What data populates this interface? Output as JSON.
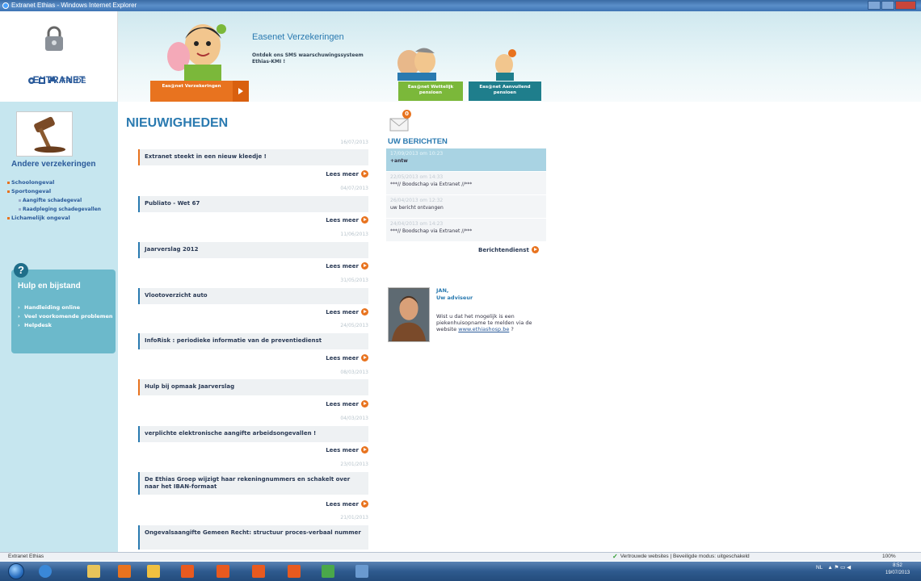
{
  "window": {
    "title": "Extranet Ethias - Windows Internet Explorer"
  },
  "header": {
    "logo_title": "EXTRANET",
    "lang_fr": "FR",
    "lang_de": "DE",
    "promo_title": "Easenet Verzekeringen",
    "promo_text": "Ontdek ons SMS waarschuwingssysteem Ethias-KMI !",
    "btn_verzekeringen": "Eas@net Verzekeringen",
    "btn_wettelijk": "Eas@net Wettelijk pensioen",
    "btn_aanvullend": "Eas@net Aanvullend pensioen"
  },
  "sidebar": {
    "title": "Andere verzekeringen",
    "items": [
      {
        "label": "Schoolongeval",
        "sub": false
      },
      {
        "label": "Sportongeval",
        "sub": false
      },
      {
        "label": "Aangifte schadegeval",
        "sub": true
      },
      {
        "label": "Raadpleging schadegevallen",
        "sub": true
      },
      {
        "label": "Lichamelijk ongeval",
        "sub": false
      }
    ],
    "help_title": "Hulp en bijstand",
    "help_items": [
      "Handleiding online",
      "Veel voorkomende problemen",
      "Helpdesk"
    ]
  },
  "news": {
    "title": "NIEUWIGHEDEN",
    "read_more": "Lees meer",
    "items": [
      {
        "date": "16/07/2013",
        "title": "Extranet steekt in een nieuw kleedje !",
        "accent": "orange"
      },
      {
        "date": "04/07/2013",
        "title": "Publiato - Wet 67",
        "accent": "blue"
      },
      {
        "date": "11/06/2013",
        "title": "Jaarverslag 2012",
        "accent": "blue"
      },
      {
        "date": "31/05/2013",
        "title": "Vlootoverzicht auto",
        "accent": "blue"
      },
      {
        "date": "24/05/2013",
        "title": "InfoRisk : periodieke informatie van de preventiedienst",
        "accent": "blue"
      },
      {
        "date": "08/03/2013",
        "title": "Hulp bij opmaak Jaarverslag",
        "accent": "orange"
      },
      {
        "date": "04/03/2013",
        "title": "verplichte elektronische aangifte arbeidsongevallen !",
        "accent": "blue"
      },
      {
        "date": "23/01/2013",
        "title": "De Ethias Groep wijzigt haar rekeningnummers en schakelt over naar het IBAN-formaat",
        "accent": "blue"
      },
      {
        "date": "21/01/2013",
        "title": "Ongevalsaangifte Gemeen Recht: structuur proces-verbaal nummer",
        "accent": "blue"
      }
    ]
  },
  "messages": {
    "badge": "0",
    "title": "UW BERICHTEN",
    "items": [
      {
        "date": "17/09/2013 om 10:23",
        "text": "+antw",
        "active": true
      },
      {
        "date": "22/05/2013 om 14:33",
        "text": "***// Boodschap via Extranet //***",
        "active": false
      },
      {
        "date": "26/04/2013 om 12:32",
        "text": "uw bericht ontvangen",
        "active": false
      },
      {
        "date": "24/04/2013 om 14:23",
        "text": "***// Boodschap via Extranet //***",
        "active": false
      }
    ],
    "service_link": "Berichtendienst"
  },
  "adviseur": {
    "name": "JAN,",
    "role": "Uw adviseur",
    "text": "Wist u dat het mogelijk is een piekenhuisopname te melden via de website",
    "link": "www.ethiashosp.be",
    "text_end": " ?"
  },
  "statusbar": {
    "left": "Extranet Ethias",
    "security": "Vertrouwde websites | Beveiligde modus: uitgeschakeld",
    "zoom": "100%"
  },
  "taskbar": {
    "lang": "NL",
    "time": "8:52",
    "date": "19/07/2013"
  },
  "colors": {
    "accent_orange": "#e8731f",
    "brand_blue": "#2a7ab0",
    "sidebar_bg": "#c6e6ef"
  }
}
